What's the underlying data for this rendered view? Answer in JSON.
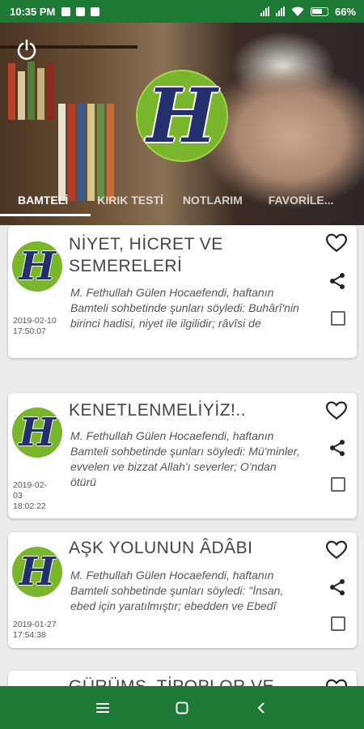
{
  "status_bar": {
    "time": "10:35 PM",
    "battery": "66%"
  },
  "tabs": [
    "BAMTELİ",
    "KIRIK TESTİ",
    "NOTLARIM",
    "FAVORİLE..."
  ],
  "cards": [
    {
      "title": "NİYET, HİCRET VE SEMERELERİ",
      "body": "M. Fethullah Gülen Hocaefendi, haftanın Bamteli sohbetinde şunları söyledi: Buhârî'nin birinci hadisi, niyet ile ilgilidir; râvîsi de",
      "date": "2019-02-10 17:50:07"
    },
    {
      "title": "KENETLENMELİYİZ!..",
      "body": "M. Fethullah Gülen Hocaefendi, haftanın Bamteli sohbetinde şunları söyledi:   Mü'minler, evvelen ve bizzat Allah'ı severler; O'ndan ötürü",
      "date": "2019-02-03 18:02:22"
    },
    {
      "title": "AŞK YOLUNUN ÂDÂBI",
      "body": "M. Fethullah Gülen Hocaefendi, haftanın Bamteli sohbetinde şunları söyledi:   \"İnsan, ebed için yaratılmıştır; ebedden ve Ebedî",
      "date": "2019-01-27 17:54:38"
    },
    {
      "title": "GÜRÜMS, TİPOPLOR VE",
      "body": "",
      "date": ""
    }
  ],
  "logo_letter": "H",
  "colors": {
    "primary": "#1d7a34",
    "logo_green": "#7ab62b",
    "logo_navy": "#24306e"
  },
  "icons": {
    "header": "power-icon",
    "card_actions": [
      "heart-icon",
      "share-icon",
      "checkbox"
    ],
    "nav": [
      "menu-icon",
      "home-square-icon",
      "back-chevron-icon"
    ]
  }
}
